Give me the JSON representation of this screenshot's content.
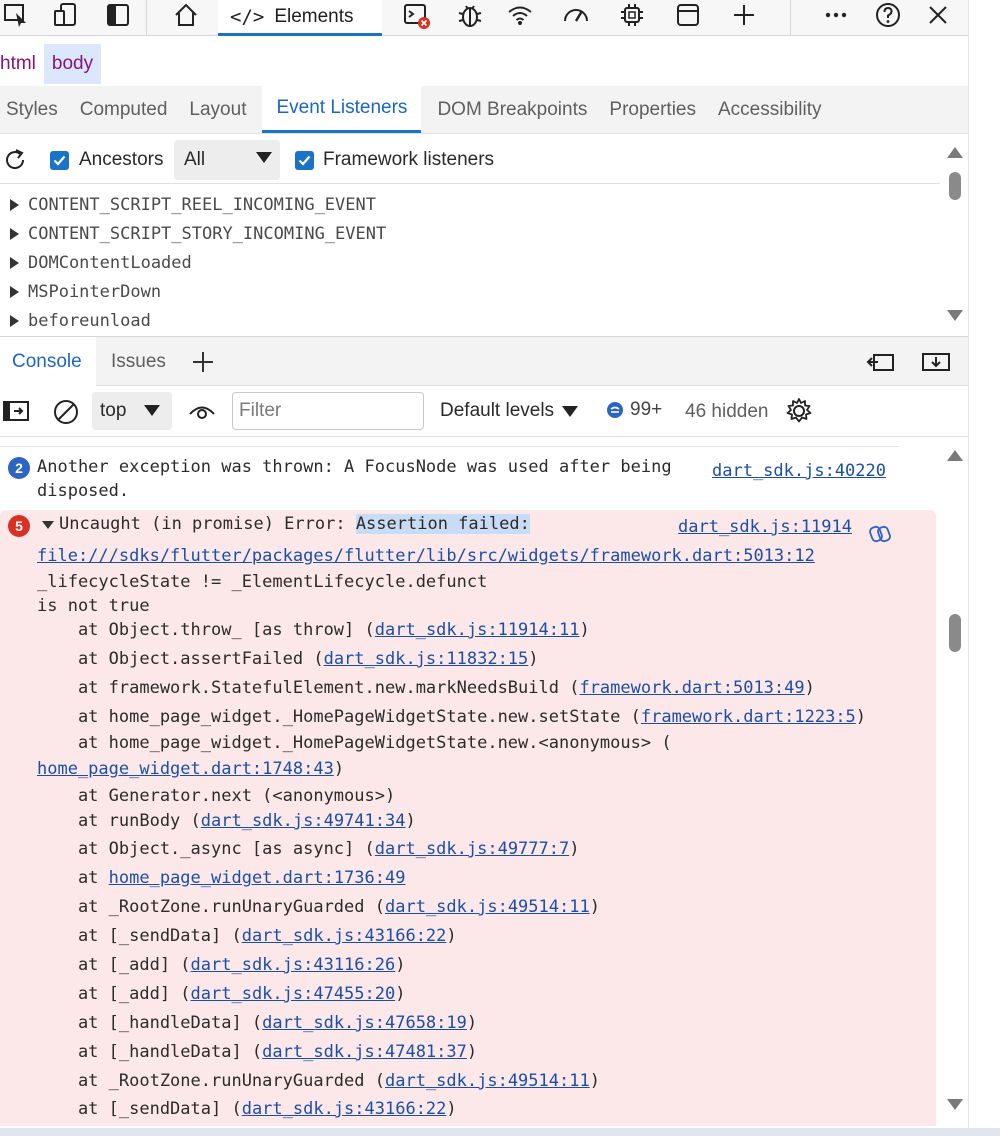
{
  "toolbar": {
    "elements_tab_label": "Elements",
    "icons": [
      "inspect-icon",
      "device-emulation-icon",
      "dock-icon",
      "welcome-icon",
      "console-error-icon",
      "bug-icon",
      "wifi-icon",
      "performance-icon",
      "memory-icon",
      "application-icon",
      "add-tool-icon",
      "more-icon",
      "help-icon",
      "close-icon"
    ]
  },
  "breadcrumb": {
    "items": [
      "html",
      "body"
    ]
  },
  "sidebar_tabs": [
    "Styles",
    "Computed",
    "Layout",
    "Event Listeners",
    "DOM Breakpoints",
    "Properties",
    "Accessibility"
  ],
  "event_options": {
    "ancestors_label": "Ancestors",
    "select_value": "All",
    "framework_label": "Framework listeners"
  },
  "event_listeners": [
    "CONTENT_SCRIPT_REEL_INCOMING_EVENT",
    "CONTENT_SCRIPT_STORY_INCOMING_EVENT",
    "DOMContentLoaded",
    "MSPointerDown",
    "beforeunload"
  ],
  "drawer_tabs": {
    "console": "Console",
    "issues": "Issues"
  },
  "console_toolbar": {
    "context": "top",
    "filter_placeholder": "Filter",
    "levels": "Default levels",
    "message_count": "99+",
    "hidden": "46 hidden"
  },
  "messages": {
    "warn": {
      "count": "2",
      "line1": "Another exception was thrown: A FocusNode was used after being",
      "line2": "disposed.",
      "link": "dart_sdk.js:40220"
    },
    "error": {
      "count": "5",
      "prefix": "Uncaught (in promise) Error: ",
      "highlight": "Assertion failed:",
      "link": "dart_sdk.js:11914",
      "file_link": "file:///sdks/flutter/packages/flutter/lib/src/widgets/framework.dart:5013:12",
      "line_state": "_lifecycleState != _ElementLifecycle.defunct",
      "line_not_true": "is not true",
      "stack": [
        {
          "pre": "    at Object.throw_ [as throw] (",
          "link": "dart_sdk.js:11914:11",
          "post": ")"
        },
        {
          "pre": "    at Object.assertFailed (",
          "link": "dart_sdk.js:11832:15",
          "post": ")"
        },
        {
          "pre": "    at framework.StatefulElement.new.markNeedsBuild (",
          "link": "framework.dart:5013:49",
          "post": ")"
        },
        {
          "pre": "    at home_page_widget._HomePageWidgetState.new.setState (",
          "link": "framework.dart:1223:5",
          "post": ")"
        },
        {
          "pre": "    at home_page_widget._HomePageWidgetState.new.<anonymous> (",
          "link": "",
          "post": ""
        },
        {
          "pre": "",
          "link": "home_page_widget.dart:1748:43",
          "post": ")"
        },
        {
          "pre": "    at Generator.next (<anonymous>)",
          "link": "",
          "post": ""
        },
        {
          "pre": "    at runBody (",
          "link": "dart_sdk.js:49741:34",
          "post": ")"
        },
        {
          "pre": "    at Object._async [as async] (",
          "link": "dart_sdk.js:49777:7",
          "post": ")"
        },
        {
          "pre": "    at ",
          "link": "home_page_widget.dart:1736:49",
          "post": ""
        },
        {
          "pre": "    at _RootZone.runUnaryGuarded (",
          "link": "dart_sdk.js:49514:11",
          "post": ")"
        },
        {
          "pre": "    at [_sendData] (",
          "link": "dart_sdk.js:43166:22",
          "post": ")"
        },
        {
          "pre": "    at [_add] (",
          "link": "dart_sdk.js:43116:26",
          "post": ")"
        },
        {
          "pre": "    at [_add] (",
          "link": "dart_sdk.js:47455:20",
          "post": ")"
        },
        {
          "pre": "    at [_handleData] (",
          "link": "dart_sdk.js:47658:19",
          "post": ")"
        },
        {
          "pre": "    at [_handleData] (",
          "link": "dart_sdk.js:47481:37",
          "post": ")"
        },
        {
          "pre": "    at _RootZone.runUnaryGuarded (",
          "link": "dart_sdk.js:49514:11",
          "post": ")"
        },
        {
          "pre": "    at [_sendData] (",
          "link": "dart_sdk.js:43166:22",
          "post": ")"
        }
      ]
    }
  },
  "colors": {
    "accent": "#1a73c7",
    "error_bg": "#fce8e8",
    "error_badge": "#d93025",
    "info_badge": "#2b64c2"
  }
}
